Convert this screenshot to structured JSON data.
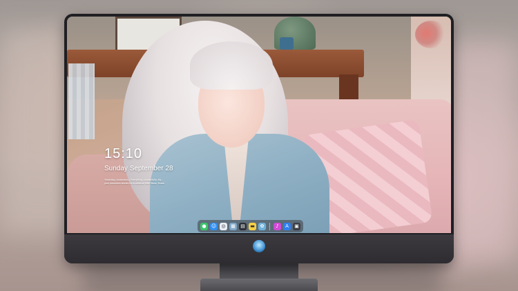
{
  "lock_screen": {
    "time": "15:10",
    "date": "Sunday September 28",
    "quote_line1": "Yesterday, bookmarks | Everything, connectivity, My...",
    "quote_line2": "your memories stories for a universe files~Book, Music"
  },
  "dock": {
    "apps": [
      {
        "name": "messages-icon",
        "glyph": "●",
        "color": "#3cc46a"
      },
      {
        "name": "finder-icon",
        "glyph": "☺",
        "color": "#2f8ef0"
      },
      {
        "name": "safari-icon",
        "glyph": "◎",
        "color": "#e8eef5"
      },
      {
        "name": "preview-icon",
        "glyph": "▦",
        "color": "#7fa6c8"
      },
      {
        "name": "launchpad-icon",
        "glyph": "▤",
        "color": "#2b2f36"
      },
      {
        "name": "notes-icon",
        "glyph": "▬",
        "color": "#f5d046"
      },
      {
        "name": "photos-icon",
        "glyph": "✿",
        "color": "#6fb0d8"
      }
    ],
    "apps_right": [
      {
        "name": "music-icon",
        "glyph": "♪",
        "color": "#d14bd6"
      },
      {
        "name": "app-store-icon",
        "glyph": "A",
        "color": "#2f7ff0"
      },
      {
        "name": "screenshot-icon",
        "glyph": "▣",
        "color": "#3a3d44"
      }
    ]
  },
  "colors": {
    "accent": "#3d8fd1",
    "bezel": "#1f1f23",
    "chin": "#3c3a3e"
  }
}
